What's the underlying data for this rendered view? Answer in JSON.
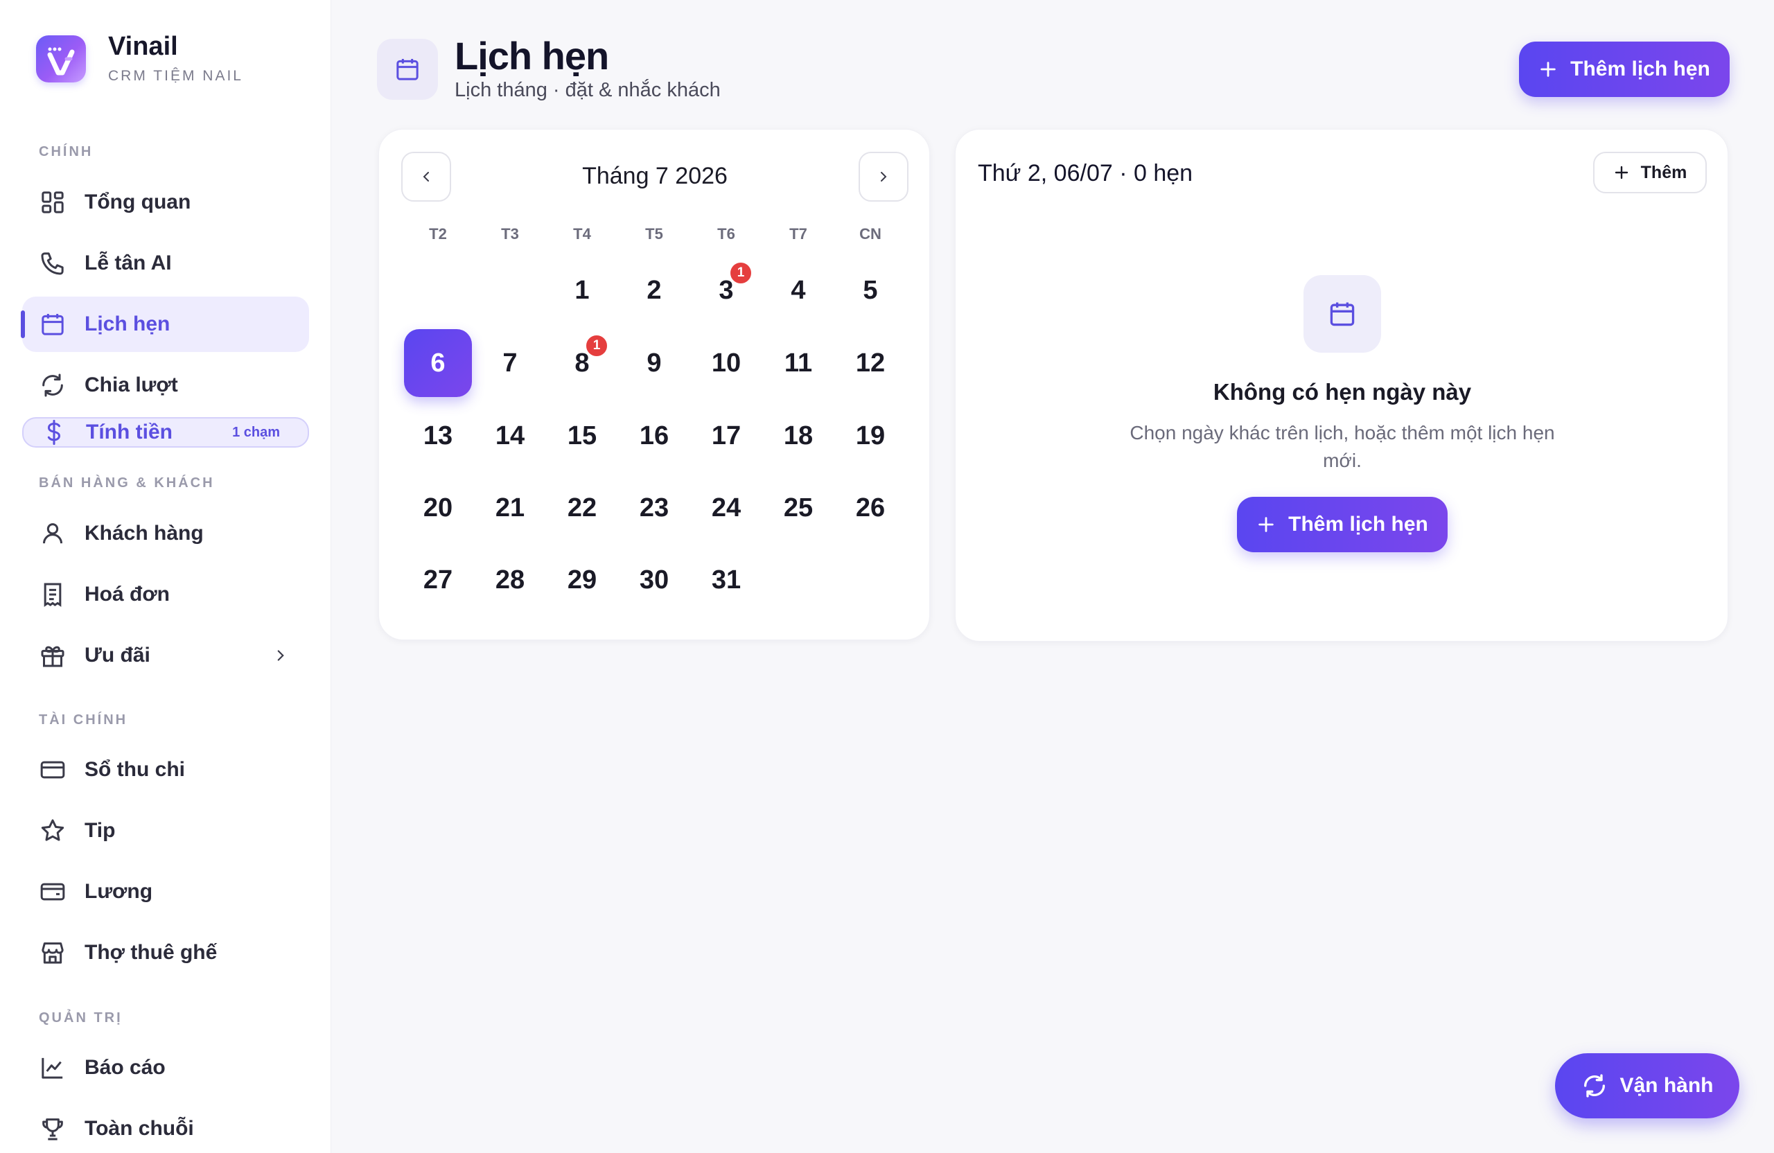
{
  "brand": {
    "name": "Vinail",
    "subtitle": "CRM TIỆM NAIL"
  },
  "sidebar": {
    "sections": [
      {
        "label": "CHÍNH"
      },
      {
        "label": "BÁN HÀNG & KHÁCH"
      },
      {
        "label": "TÀI CHÍNH"
      },
      {
        "label": "QUẢN TRỊ"
      }
    ],
    "items": [
      {
        "label": "Tổng quan",
        "icon": "grid-icon"
      },
      {
        "label": "Lễ tân AI",
        "icon": "phone-icon"
      },
      {
        "label": "Lịch hẹn",
        "icon": "calendar-icon",
        "active": true
      },
      {
        "label": "Chia lượt",
        "icon": "refresh-icon"
      },
      {
        "label": "Tính tiền",
        "icon": "dollar-icon",
        "badge": "1 chạm"
      },
      {
        "label": "Khách hàng",
        "icon": "user-icon"
      },
      {
        "label": "Hoá đơn",
        "icon": "receipt-icon"
      },
      {
        "label": "Ưu đãi",
        "icon": "gift-icon"
      },
      {
        "label": "Sổ thu chi",
        "icon": "card-icon"
      },
      {
        "label": "Tip",
        "icon": "star-icon"
      },
      {
        "label": "Lương",
        "icon": "wallet-icon"
      },
      {
        "label": "Thợ thuê ghế",
        "icon": "store-icon"
      },
      {
        "label": "Báo cáo",
        "icon": "chart-icon"
      },
      {
        "label": "Toàn chuỗi",
        "icon": "trophy-icon"
      }
    ]
  },
  "header": {
    "title": "Lịch hẹn",
    "subtitle": "Lịch tháng · đặt & nhắc khách",
    "add_button": "Thêm lịch hẹn"
  },
  "calendar": {
    "month_label": "Tháng 7 2026",
    "weekdays": [
      "T2",
      "T3",
      "T4",
      "T5",
      "T6",
      "T7",
      "CN"
    ],
    "first_weekday_index": 2,
    "days_in_month": 31,
    "selected_day": 6,
    "appointment_counts": {
      "3": "1",
      "8": "1"
    }
  },
  "detail": {
    "title": "Thứ 2, 06/07 · 0 hẹn",
    "add_button": "Thêm",
    "empty_title": "Không có hẹn ngày này",
    "empty_desc": "Chọn ngày khác trên lịch, hoặc thêm một lịch hẹn mới.",
    "empty_button": "Thêm lịch hẹn"
  },
  "floating": {
    "label": "Vận hành"
  },
  "colors": {
    "accent": "#5a46f0",
    "accent2": "#7b46ec",
    "badge": "#e53e3e"
  }
}
